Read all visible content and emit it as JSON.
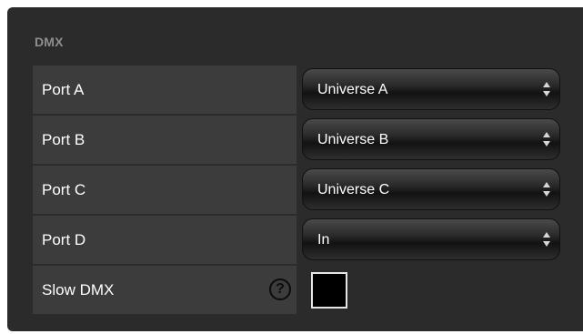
{
  "panel": {
    "title": "DMX"
  },
  "rows": [
    {
      "label": "Port A",
      "value": "Universe A"
    },
    {
      "label": "Port B",
      "value": "Universe B"
    },
    {
      "label": "Port C",
      "value": "Universe C"
    },
    {
      "label": "Port D",
      "value": "In"
    }
  ],
  "slow_dmx": {
    "label": "Slow DMX",
    "help_glyph": "?",
    "checked": false
  },
  "icons": {
    "help": "question-mark-circle-icon",
    "select_arrows": "up-down-arrows-icon"
  },
  "colors": {
    "panel_bg": "#2b2b2b",
    "label_bg": "#3c3c3c",
    "title": "#8e8e8e",
    "text": "#ffffff"
  }
}
